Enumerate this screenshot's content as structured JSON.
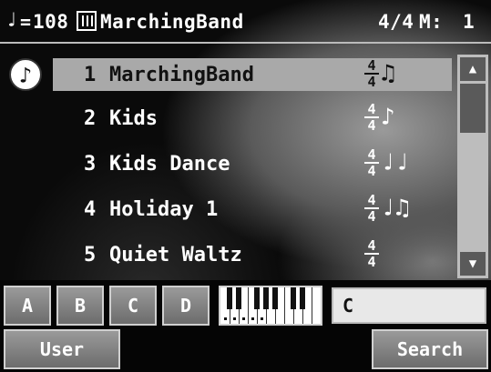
{
  "header": {
    "tempo_symbol": "=",
    "tempo": "108",
    "rhythm_name": "MarchingBand",
    "beat": "4/4",
    "measure_label": "M:",
    "measure": "1"
  },
  "rhythms": [
    {
      "number": "1",
      "name": "MarchingBand",
      "time_top": "4",
      "time_bottom": "4",
      "note_glyph": "♫",
      "selected": true
    },
    {
      "number": "2",
      "name": "Kids",
      "time_top": "4",
      "time_bottom": "4",
      "note_glyph": "♪",
      "selected": false
    },
    {
      "number": "3",
      "name": "Kids Dance",
      "time_top": "4",
      "time_bottom": "4",
      "note_glyph": "♩♩",
      "selected": false
    },
    {
      "number": "4",
      "name": "Holiday 1",
      "time_top": "4",
      "time_bottom": "4",
      "note_glyph": "♩♫",
      "selected": false
    },
    {
      "number": "5",
      "name": "Quiet Waltz",
      "time_top": "4",
      "time_bottom": "4",
      "note_glyph": "",
      "selected": false
    }
  ],
  "group_buttons": [
    "A",
    "B",
    "C",
    "D"
  ],
  "search_value": "C",
  "user_label": "User",
  "search_label": "Search",
  "icons": {
    "tempo_note": "quarter-note-icon",
    "rhythm": "rhythm-icon",
    "play": "music-note-icon",
    "scroll_up": "triangle-up-icon",
    "scroll_down": "triangle-down-icon",
    "keyboard": "keyboard-icon"
  }
}
